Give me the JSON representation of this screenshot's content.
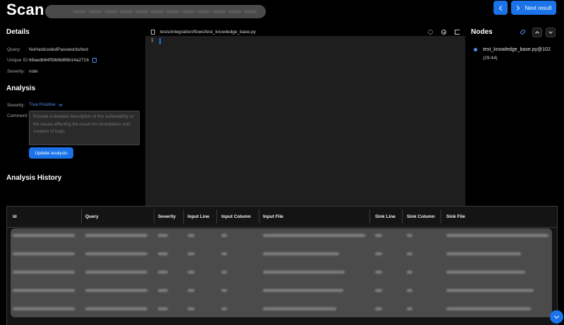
{
  "header": {
    "title": "Scan",
    "next_label": "Next result"
  },
  "details": {
    "heading": "Details",
    "query_label": "Query:",
    "query_value": "NoHardcodedPasswords/test",
    "uid_label": "Unique ID:",
    "uid_value": "68aedb64f58b6d86b14a2716",
    "severity_label": "Severity:",
    "severity_value": "note"
  },
  "analysis": {
    "heading": "Analysis",
    "severity_label": "Severity:",
    "severity_value": "True Positive",
    "comment_label": "Comment:",
    "comment_placeholder": "Provide a detailed description of the vulnerability or the issues affecting the result for remediation and creation of bugs.",
    "update_label": "Update analysis"
  },
  "history": {
    "heading": "Analysis History",
    "columns": [
      "Id",
      "Query",
      "Severity",
      "Input Line",
      "Input Column",
      "Input File",
      "Sink Line",
      "Sink Column",
      "Sink File"
    ]
  },
  "editor": {
    "file_path": "tests/integration/flows/test_knowledge_base.py",
    "line_number": "1"
  },
  "nodes": {
    "heading": "Nodes",
    "items": [
      {
        "label": "test_knowledge_base.py@102",
        "position": "(29:44)"
      }
    ]
  },
  "colors": {
    "accent": "#1a73e8",
    "background": "#000000",
    "editor_bg": "#1e1e1e"
  }
}
